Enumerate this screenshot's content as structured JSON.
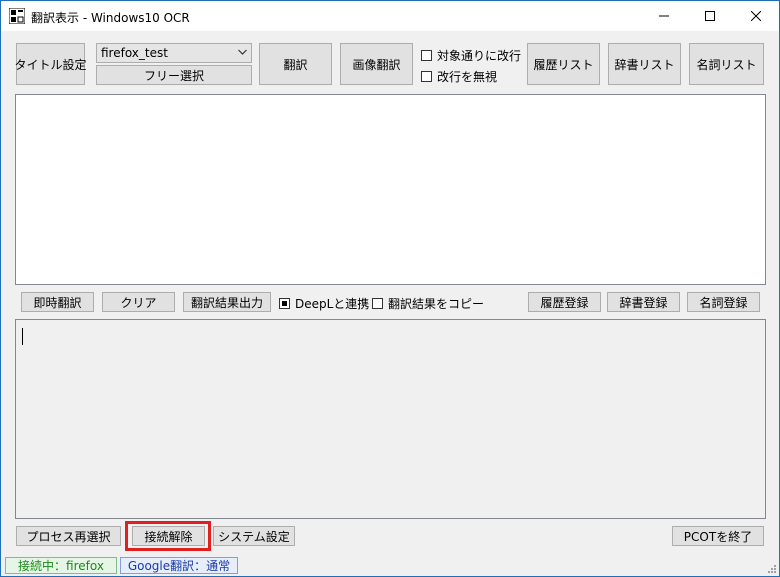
{
  "window": {
    "title": "翻訳表示 - Windows10 OCR",
    "minimize": "minimize",
    "maximize": "maximize",
    "close": "close"
  },
  "toolbar": {
    "title_setting": "タイトル設定",
    "process_value": "firefox_test",
    "free_select": "フリー選択",
    "translate": "翻訳",
    "image_translate": "画像翻訳",
    "chk_linebreak": "対象通りに改行",
    "chk_ignore_linebreak": "改行を無視",
    "history_list": "履歴リスト",
    "dict_list": "辞書リスト",
    "noun_list": "名詞リスト"
  },
  "middle": {
    "instant_translate": "即時翻訳",
    "clear": "クリア",
    "output_result": "翻訳結果出力",
    "chk_deepl": "DeepLと連携",
    "deepl_checked": true,
    "chk_copy_result": "翻訳結果をコピー",
    "history_register": "履歴登録",
    "dict_register": "辞書登録",
    "noun_register": "名詞登録"
  },
  "bottom": {
    "reselect_process": "プロセス再選択",
    "disconnect": "接続解除",
    "system_settings": "システム設定",
    "exit": "PCOTを終了"
  },
  "statusbar": {
    "connection": "接続中：firefox",
    "google_mode": "Google翻訳：通常"
  },
  "colors": {
    "highlight": "#e02020",
    "status_connection_text": "#1a8a1a",
    "status_connection_bg": "#e6f6e6",
    "status_google_text": "#1a3aa8",
    "status_google_bg": "#e6eefc"
  }
}
